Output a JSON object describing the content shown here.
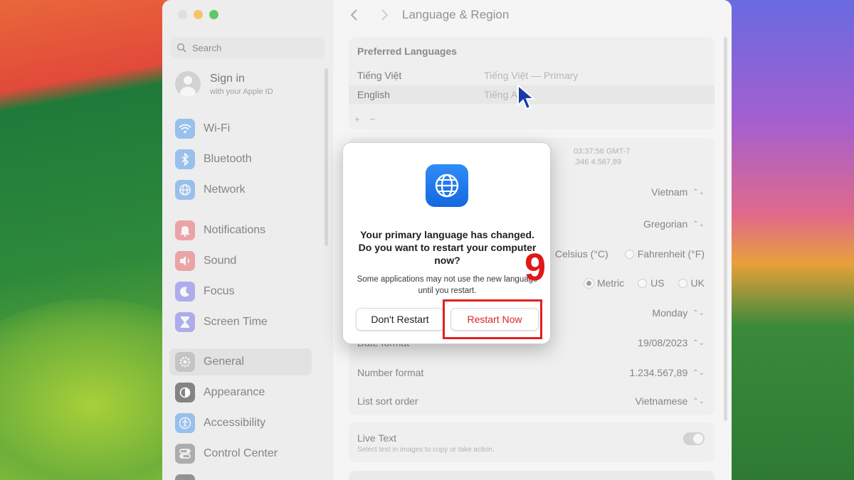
{
  "window": {
    "title": "Language & Region"
  },
  "sidebar": {
    "search_placeholder": "Search",
    "signin": {
      "title": "Sign in",
      "subtitle": "with your Apple ID"
    },
    "items": [
      {
        "label": "Wi-Fi",
        "icon": "wifi-icon",
        "color": "#2f86e8"
      },
      {
        "label": "Bluetooth",
        "icon": "bluetooth-icon",
        "color": "#2f86e8"
      },
      {
        "label": "Network",
        "icon": "globe-icon",
        "color": "#2f86e8"
      },
      {
        "label": "Notifications",
        "icon": "bell-icon",
        "color": "#e5484d"
      },
      {
        "label": "Sound",
        "icon": "speaker-icon",
        "color": "#e5484d"
      },
      {
        "label": "Focus",
        "icon": "moon-icon",
        "color": "#5e5ce6"
      },
      {
        "label": "Screen Time",
        "icon": "hourglass-icon",
        "color": "#5e5ce6"
      },
      {
        "label": "General",
        "icon": "gear-icon",
        "color": "#8e8e93"
      },
      {
        "label": "Appearance",
        "icon": "appearance-icon",
        "color": "#1c1c1e"
      },
      {
        "label": "Accessibility",
        "icon": "accessibility-icon",
        "color": "#2f86e8"
      },
      {
        "label": "Control Center",
        "icon": "control-center-icon",
        "color": "#8e8e93"
      }
    ]
  },
  "preferred_languages": {
    "title": "Preferred Languages",
    "languages": [
      {
        "name": "Tiếng Việt",
        "native": "Tiếng Việt — Primary"
      },
      {
        "name": "English",
        "native": "Tiếng A"
      }
    ],
    "add": "+",
    "remove": "−"
  },
  "region": {
    "example_line1": "03:37:56 GMT-7",
    "example_line2": ".346    4.567,89",
    "rows": {
      "region": "Vietnam",
      "calendar": "Gregorian",
      "celsius": "Celsius (°C)",
      "fahrenheit": "Fahrenheit (°F)",
      "metric": "Metric",
      "us": "US",
      "uk": "UK",
      "first_day": "Monday",
      "date_format_label": "Date format",
      "date_format": "19/08/2023",
      "number_format_label": "Number format",
      "number_format": "1.234.567,89",
      "list_sort_label": "List sort order",
      "list_sort": "Vietnamese"
    }
  },
  "live_text": {
    "title": "Live Text",
    "subtitle": "Select text in images to copy or take action."
  },
  "dialog": {
    "title": "Your primary language has changed. Do you want to restart your computer now?",
    "message": "Some applications may not use the new language until you restart.",
    "dont_restart": "Don't Restart",
    "restart_now": "Restart Now"
  },
  "annotation": {
    "step": "9",
    "color": "#e01818"
  }
}
